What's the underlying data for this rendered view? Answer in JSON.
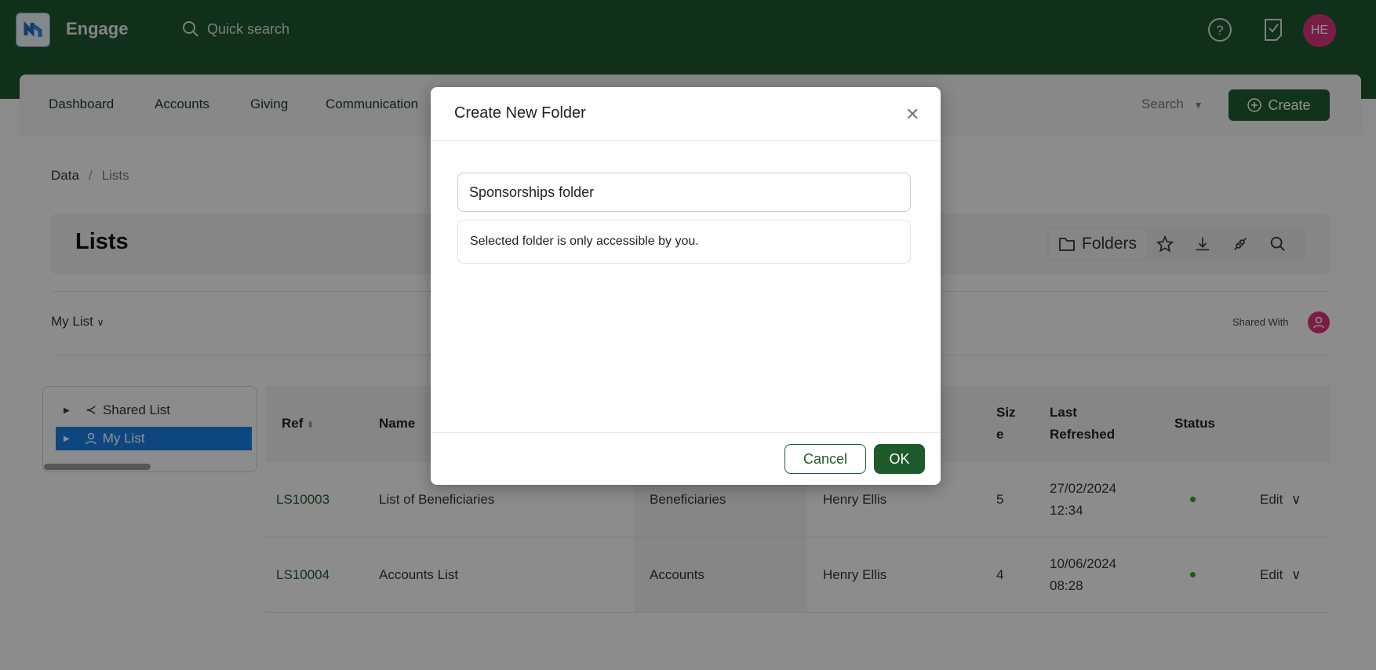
{
  "app": {
    "name": "Engage",
    "quick_search": "Quick search",
    "user_initials": "HE"
  },
  "colors": {
    "brand_green": "#1f552c",
    "avatar": "#d6337c",
    "selected": "#1a7ce0",
    "status_active": "#3a9a2e"
  },
  "nav": {
    "items": [
      "Dashboard",
      "Accounts",
      "Giving",
      "Communication"
    ],
    "search": "Search",
    "create": "Create"
  },
  "breadcrumb": {
    "parent": "Data",
    "separator": "/",
    "current": "Lists"
  },
  "page": {
    "title": "Lists",
    "folders": "Folders",
    "view": "My List",
    "shared_with": "Shared With"
  },
  "tree": {
    "items": [
      {
        "label": "Shared List",
        "icon": "share-icon"
      },
      {
        "label": "My List",
        "icon": "user-icon",
        "selected": true
      }
    ]
  },
  "table": {
    "headers": {
      "ref": "Ref",
      "name": "Name",
      "size": "Size",
      "last_refreshed": "Last Refreshed",
      "status": "Status"
    },
    "rows": [
      {
        "ref": "LS10003",
        "name": "List of Beneficiaries",
        "type": "Beneficiaries",
        "owner": "Henry Ellis",
        "size": "5",
        "date": "27/02/2024",
        "time": "12:34",
        "status": "active",
        "action": "Edit"
      },
      {
        "ref": "LS10004",
        "name": "Accounts List",
        "type": "Accounts",
        "owner": "Henry Ellis",
        "size": "4",
        "date": "10/06/2024",
        "time": "08:28",
        "status": "active",
        "action": "Edit"
      }
    ]
  },
  "dialog": {
    "title": "Create New Folder",
    "folder_name": "Sponsorships folder",
    "info": "Selected folder is only accessible by you.",
    "cancel": "Cancel",
    "ok": "OK"
  }
}
